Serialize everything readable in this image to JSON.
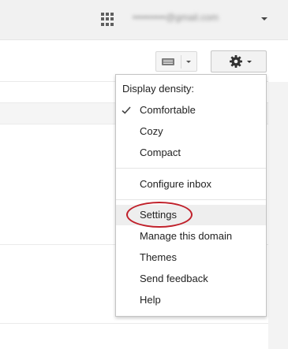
{
  "header": {
    "apps_icon": "apps-grid-icon",
    "account_email": "••••••••••@gmail.com",
    "account_menu_icon": "caret-down-icon"
  },
  "toolbar": {
    "input_tools_icon": "keyboard-icon",
    "settings_icon": "gear-icon"
  },
  "settings_menu": {
    "density_heading": "Display density:",
    "density_options": [
      {
        "label": "Comfortable",
        "selected": true
      },
      {
        "label": "Cozy",
        "selected": false
      },
      {
        "label": "Compact",
        "selected": false
      }
    ],
    "configure_inbox": "Configure inbox",
    "items": [
      {
        "label": "Settings",
        "highlighted": true
      },
      {
        "label": "Manage this domain",
        "highlighted": false
      },
      {
        "label": "Themes",
        "highlighted": false
      },
      {
        "label": "Send feedback",
        "highlighted": false
      },
      {
        "label": "Help",
        "highlighted": false
      }
    ]
  },
  "colors": {
    "annotation_circle": "#c0202a",
    "highlight": "#eeeeee"
  }
}
